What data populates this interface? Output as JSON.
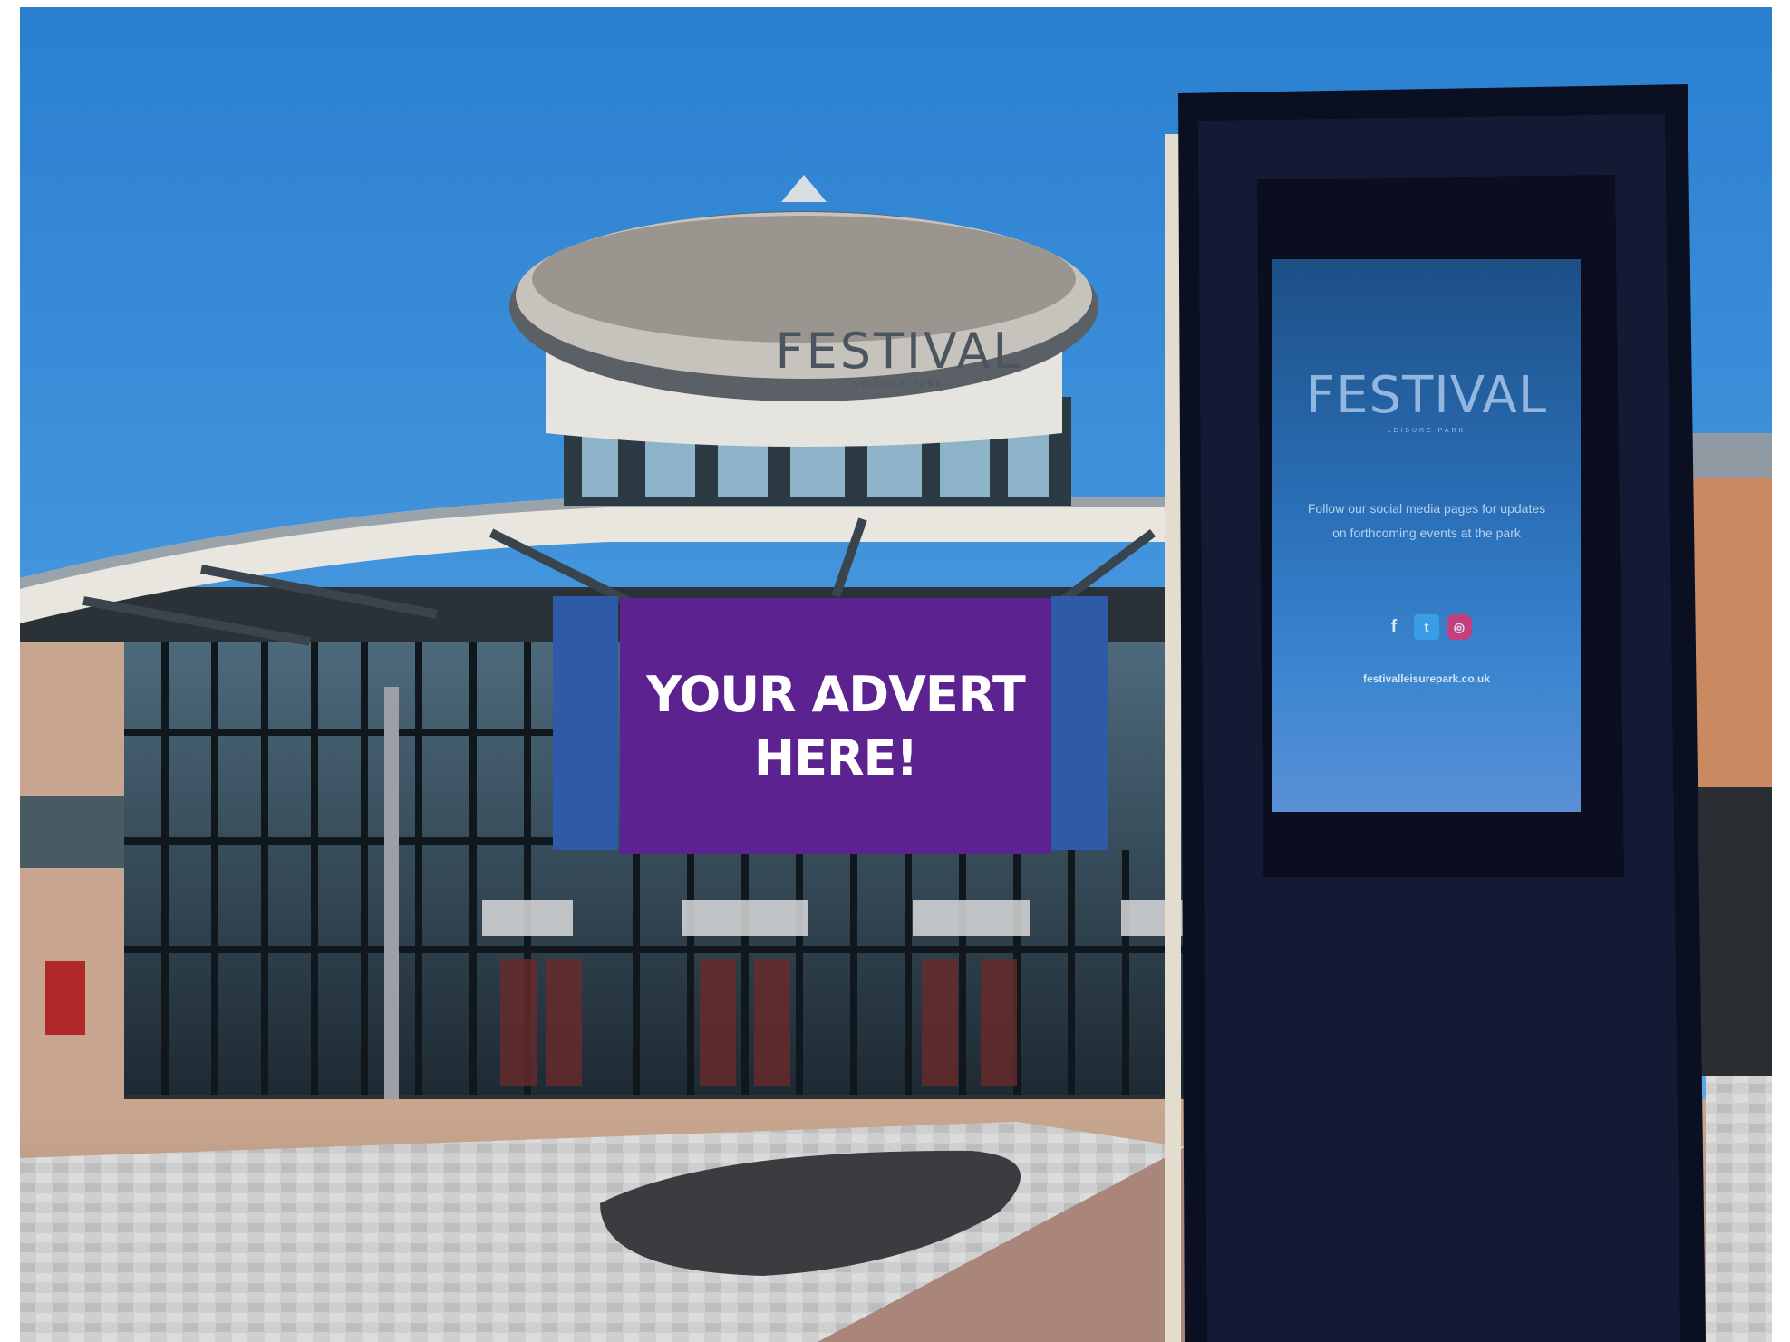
{
  "dome_sign": {
    "brand": "FESTIVAL",
    "subtitle": "LEISURE PARK"
  },
  "advert": {
    "text": "YOUR ADVERT\nHERE!",
    "background": "#5c2290"
  },
  "kiosk": {
    "brand": "FESTIVAL",
    "subtitle": "LEISURE PARK",
    "message": "Follow our social media pages for updates on forthcoming events at the park",
    "social": [
      {
        "icon": "facebook-icon",
        "glyph": "f"
      },
      {
        "icon": "twitter-icon",
        "glyph": "t"
      },
      {
        "icon": "instagram-icon",
        "glyph": "◎"
      }
    ],
    "url": "festivalleisurepark.co.uk"
  }
}
